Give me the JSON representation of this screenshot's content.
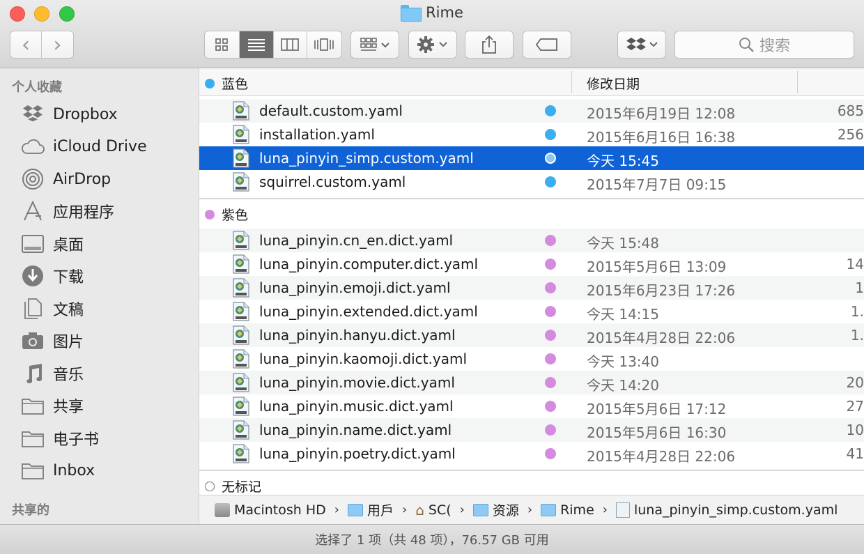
{
  "window": {
    "title": "Rime"
  },
  "toolbar": {
    "back_glyph": "‹",
    "forward_glyph": "›",
    "search_placeholder": "搜索"
  },
  "sidebar": {
    "favorites_header": "个人收藏",
    "items": [
      {
        "label": "Dropbox",
        "icon": "dropbox-icon"
      },
      {
        "label": "iCloud Drive",
        "icon": "cloud-icon"
      },
      {
        "label": "AirDrop",
        "icon": "airdrop-icon"
      },
      {
        "label": "应用程序",
        "icon": "applications-icon"
      },
      {
        "label": "桌面",
        "icon": "desktop-icon"
      },
      {
        "label": "下载",
        "icon": "download-icon"
      },
      {
        "label": "文稿",
        "icon": "documents-icon"
      },
      {
        "label": "图片",
        "icon": "camera-icon"
      },
      {
        "label": "音乐",
        "icon": "music-icon"
      },
      {
        "label": "共享",
        "icon": "folder-icon"
      },
      {
        "label": "电子书",
        "icon": "folder-icon"
      },
      {
        "label": "Inbox",
        "icon": "folder-icon"
      }
    ],
    "shared_header": "共享的"
  },
  "columns": {
    "name": "蓝色",
    "date": "修改日期"
  },
  "groups": [
    {
      "label": "蓝色",
      "color": "#3aaef0",
      "files": [
        {
          "name": "default.custom.yaml",
          "date": "2015年6月19日 12:08",
          "size": "685"
        },
        {
          "name": "installation.yaml",
          "date": "2015年6月16日 16:38",
          "size": "256"
        },
        {
          "name": "luna_pinyin_simp.custom.yaml",
          "date": "今天 15:45",
          "size": ""
        },
        {
          "name": "squirrel.custom.yaml",
          "date": "2015年7月7日 09:15",
          "size": ""
        }
      ]
    },
    {
      "label": "紫色",
      "color": "#d48bdf",
      "files": [
        {
          "name": "luna_pinyin.cn_en.dict.yaml",
          "date": "今天 15:48",
          "size": ""
        },
        {
          "name": "luna_pinyin.computer.dict.yaml",
          "date": "2015年5月6日 13:09",
          "size": "14"
        },
        {
          "name": "luna_pinyin.emoji.dict.yaml",
          "date": "2015年6月23日 17:26",
          "size": "1"
        },
        {
          "name": "luna_pinyin.extended.dict.yaml",
          "date": "今天 14:15",
          "size": "1."
        },
        {
          "name": "luna_pinyin.hanyu.dict.yaml",
          "date": "2015年4月28日 22:06",
          "size": "1."
        },
        {
          "name": "luna_pinyin.kaomoji.dict.yaml",
          "date": "今天 13:40",
          "size": ""
        },
        {
          "name": "luna_pinyin.movie.dict.yaml",
          "date": "今天 14:20",
          "size": "20"
        },
        {
          "name": "luna_pinyin.music.dict.yaml",
          "date": "2015年5月6日 17:12",
          "size": "27"
        },
        {
          "name": "luna_pinyin.name.dict.yaml",
          "date": "2015年5月6日 16:30",
          "size": "10"
        },
        {
          "name": "luna_pinyin.poetry.dict.yaml",
          "date": "2015年4月28日 22:06",
          "size": "41"
        }
      ]
    }
  ],
  "untagged_label": "无标记",
  "pathbar": {
    "crumbs": [
      "Macintosh HD",
      "用戶",
      "SC(",
      "资源",
      "Rime",
      "luna_pinyin_simp.custom.yaml"
    ]
  },
  "status": {
    "text": "选择了 1 项（共 48 项），76.57 GB 可用"
  },
  "colors": {
    "selection": "#0f63d6",
    "blue_tag": "#3aaef0",
    "purple_tag": "#d48bdf"
  }
}
